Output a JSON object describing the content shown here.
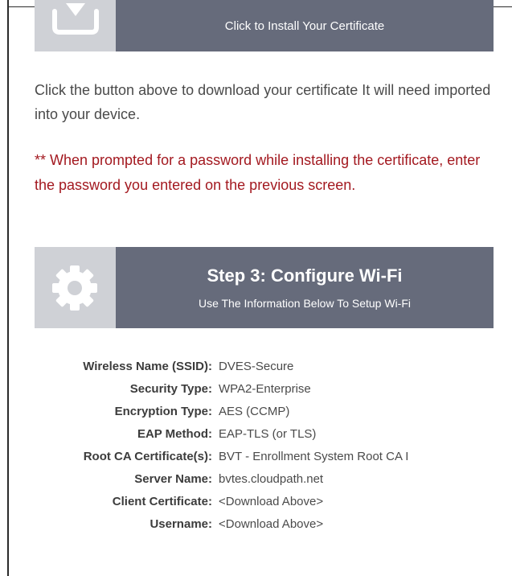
{
  "install": {
    "button_label": "Click to Install Your Certificate",
    "icon": "download-tray-icon"
  },
  "intro": {
    "text": "Click the button above to download your certificate It will need imported into your device."
  },
  "warning": {
    "text": "** When prompted for a password while installing the certificate, enter the password you entered on the previous screen.",
    "color": "#a31920"
  },
  "step3": {
    "title": "Step 3: Configure Wi-Fi",
    "subtitle": "Use The Information Below To Setup Wi-Fi",
    "icon": "gear-icon"
  },
  "settings": [
    {
      "label": "Wireless Name (SSID):",
      "value": "DVES-Secure"
    },
    {
      "label": "Security Type:",
      "value": "WPA2-Enterprise"
    },
    {
      "label": "Encryption Type:",
      "value": "AES (CCMP)"
    },
    {
      "label": "EAP Method:",
      "value": "EAP-TLS (or TLS)"
    },
    {
      "label": "Root CA Certificate(s):",
      "value": "BVT - Enrollment System Root CA I"
    },
    {
      "label": "Server Name:",
      "value": "bvtes.cloudpath.net"
    },
    {
      "label": "Client Certificate:",
      "value": "<Download Above>"
    },
    {
      "label": "Username:",
      "value": "<Download Above>"
    }
  ],
  "colors": {
    "banner_dark": "#666b7b",
    "banner_light": "#cfd1d6",
    "warning": "#a31920"
  }
}
